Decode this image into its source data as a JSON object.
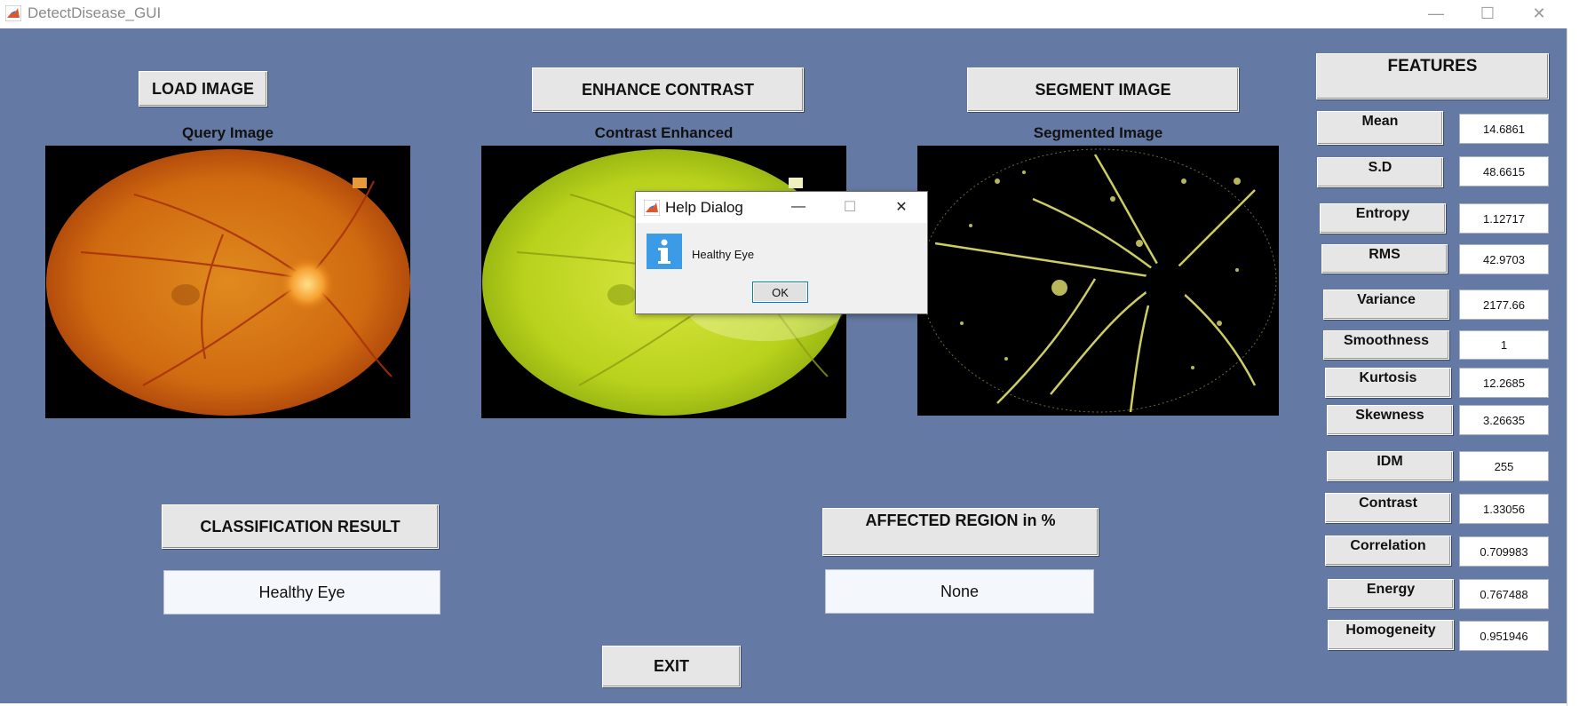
{
  "window": {
    "title": "DetectDisease_GUI",
    "minimize": "—",
    "maximize": "☐",
    "close": "✕"
  },
  "buttons": {
    "load": "LOAD IMAGE",
    "enhance": "ENHANCE CONTRAST",
    "segment": "SEGMENT IMAGE",
    "classification": "CLASSIFICATION RESULT",
    "affected": "AFFECTED REGION in %",
    "exit": "EXIT"
  },
  "panels": {
    "query_label": "Query Image",
    "enhanced_label": "Contrast Enhanced",
    "segmented_label": "Segmented Image"
  },
  "results": {
    "classification_value": "Healthy Eye",
    "affected_value": "None"
  },
  "features": {
    "header": "FEATURES",
    "items": [
      {
        "label": "Mean",
        "value": "14.6861"
      },
      {
        "label": "S.D",
        "value": "48.6615"
      },
      {
        "label": "Entropy",
        "value": "1.12717"
      },
      {
        "label": "RMS",
        "value": "42.9703"
      },
      {
        "label": "Variance",
        "value": "2177.66"
      },
      {
        "label": "Smoothness",
        "value": "1"
      },
      {
        "label": "Kurtosis",
        "value": "12.2685"
      },
      {
        "label": "Skewness",
        "value": "3.26635"
      },
      {
        "label": "IDM",
        "value": "255"
      },
      {
        "label": "Contrast",
        "value": "1.33056"
      },
      {
        "label": "Correlation",
        "value": "0.709983"
      },
      {
        "label": "Energy",
        "value": "0.767488"
      },
      {
        "label": "Homogeneity",
        "value": "0.951946"
      }
    ]
  },
  "dialog": {
    "title": "Help Dialog",
    "message": "Healthy Eye",
    "ok": "OK",
    "icon": "info-icon"
  },
  "colors": {
    "background": "#6479a3",
    "button_face": "#e6e6e6",
    "info_blue": "#3b9be6"
  }
}
